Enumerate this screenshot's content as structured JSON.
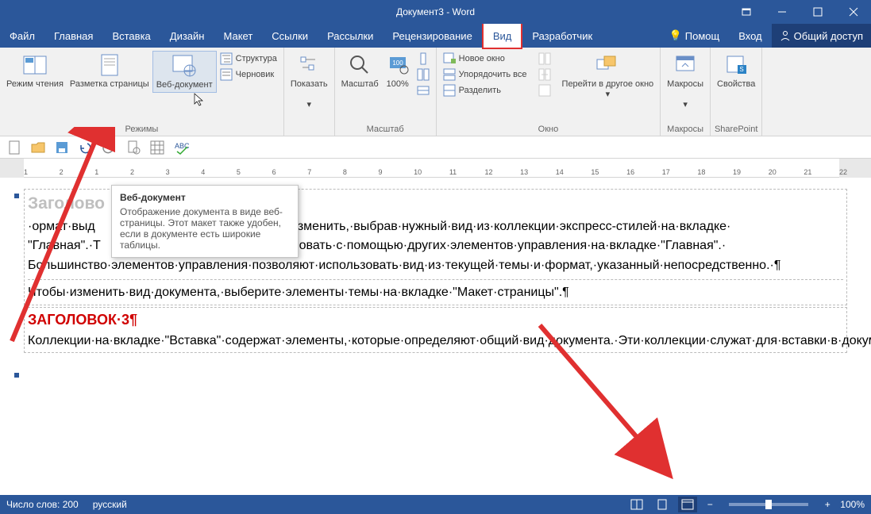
{
  "titlebar": {
    "title": "Документ3 - Word"
  },
  "menubar": {
    "file": "Файл",
    "tabs": [
      "Главная",
      "Вставка",
      "Дизайн",
      "Макет",
      "Ссылки",
      "Рассылки",
      "Рецензирование",
      "Вид",
      "Разработчик"
    ],
    "active_index": 7,
    "help": "Помощ",
    "signin": "Вход",
    "share": "Общий доступ"
  },
  "ribbon": {
    "views": {
      "read": "Режим чтения",
      "print": "Разметка страницы",
      "web": "Веб-документ",
      "outline": "Структура",
      "draft": "Черновик",
      "group": "Режимы"
    },
    "show": {
      "btn": "Показать"
    },
    "zoom": {
      "zoom": "Масштаб",
      "hundred": "100%",
      "group": "Масштаб"
    },
    "window": {
      "new": "Новое окно",
      "arrange": "Упорядочить все",
      "split": "Разделить",
      "switch": "Перейти в другое окно",
      "group": "Окно"
    },
    "macros": {
      "btn": "Макросы",
      "group": "Макросы"
    },
    "sharepoint": {
      "btn": "Свойства",
      "group": "SharePoint"
    }
  },
  "ruler": {
    "marks": [
      1,
      2,
      1,
      2,
      3,
      4,
      5,
      6,
      7,
      8,
      9,
      10,
      11,
      12,
      13,
      14,
      15,
      16,
      17,
      18,
      19,
      20,
      21,
      22
    ]
  },
  "tooltip": {
    "title": "Веб-документ",
    "body": "Отображение документа в виде веб-страницы. Этот макет также удобен, если в документе есть широкие таблицы."
  },
  "document": {
    "h2": "Заголово",
    "p1": "·ормат·выд|                                                                 |о·изменить,·выбрав·нужный·вид·из·коллекции·экспресс-стилей·на·вкладке·\"Главная\".·Т|                                                                 |ировать·с·помощью·других·элементов·управления·на·вкладке·\"Главная\".·Большинство·элементов·управления·позволяют·использовать·вид·из·текущей·темы·и·формат,·указанный·непосредственно.·¶",
    "p2": "Чтобы·изменить·вид·документа,·выберите·элементы·темы·на·вкладке·\"Макет·страницы\".¶",
    "h3": "ЗАГОЛОВОК·3¶",
    "p3": "Коллекции·на·вкладке·\"Вставка\"·содержат·элементы,·которые·определяют·общий·вид·документа.·Эти·коллекции·служат·для·вставки·в·документ·таблиц,·колонтитулов,·списков,·титульных·страниц·и·других·стандартных·блоков.·При·создании·рисунков,·диаграмм·или·схем·они·согласовываются·с·видом·текущего·документа.¶"
  },
  "statusbar": {
    "words": "Число слов: 200",
    "lang": "русский",
    "zoom": "100%"
  }
}
